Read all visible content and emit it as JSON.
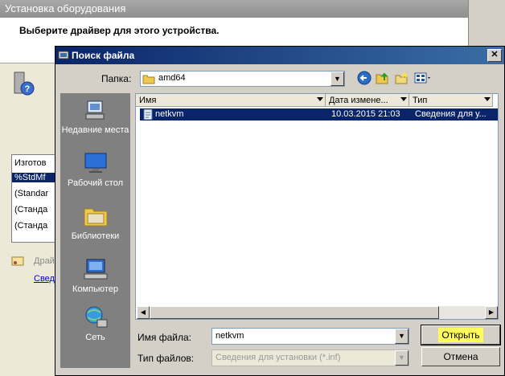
{
  "background_window": {
    "title": "Установка оборудования",
    "heading": "Выберите драйвер для этого устройства.",
    "list_header": "Изготов",
    "list_items": [
      "%StdMf",
      "(Standar",
      "(Станда",
      "(Станда"
    ],
    "driver_text": "Драй",
    "link_text": "Свед"
  },
  "dialog": {
    "title": "Поиск файла",
    "close_glyph": "✕",
    "folder_label": "Папка:",
    "folder_value": "amd64",
    "places": [
      {
        "label": "Недавние места"
      },
      {
        "label": "Рабочий стол"
      },
      {
        "label": "Библиотеки"
      },
      {
        "label": "Компьютер"
      },
      {
        "label": "Сеть"
      }
    ],
    "columns": [
      "Имя",
      "Дата измене...",
      "Тип"
    ],
    "files": [
      {
        "name": "netkvm",
        "date": "10.03.2015 21:03",
        "type": "Сведения для у..."
      }
    ],
    "filename_label": "Имя файла:",
    "filename_value": "netkvm",
    "filetype_label": "Тип файлов:",
    "filetype_value": "Сведения для установки (*.inf)",
    "open_label": "Открыть",
    "cancel_label": "Отмена"
  }
}
